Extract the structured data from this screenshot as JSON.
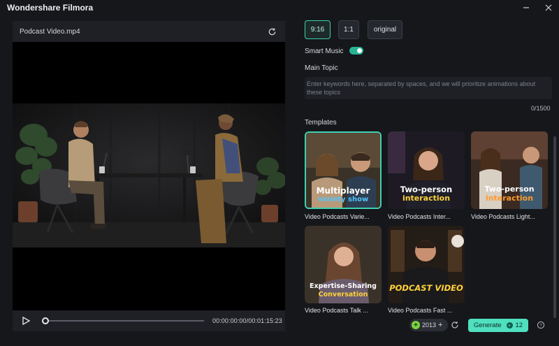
{
  "app": {
    "title": "Wondershare Filmora"
  },
  "preview": {
    "file_name": "Podcast Video.mp4",
    "time": "00:00:00:00/00:01:15:23"
  },
  "aspect_ratios": [
    "9:16",
    "1:1",
    "original"
  ],
  "selected_ratio": "9:16",
  "smart_music": {
    "label": "Smart Music",
    "enabled": true
  },
  "main_topic": {
    "label": "Main Topic",
    "placeholder": "Enter keywords here, separated by spaces, and we will prioritize animations about these topics",
    "count": "0/1500"
  },
  "templates": {
    "label": "Templates",
    "items": [
      {
        "name": "Video Podcasts Varie...",
        "overlay": [
          "Multiplayer",
          "variety show"
        ],
        "selected": true
      },
      {
        "name": "Video Podcasts Inter...",
        "overlay": [
          "Two-person",
          "interaction"
        ],
        "selected": false
      },
      {
        "name": "Video Podcasts Light...",
        "overlay": [
          "Two-person",
          "interaction"
        ],
        "selected": false
      },
      {
        "name": "Video Podcasts Talk ...",
        "overlay": [
          "Expertise-Sharing",
          "Conversation"
        ],
        "selected": false
      },
      {
        "name": "Video Podcasts Fast ...",
        "overlay": [
          "PODCAST VIDEO"
        ],
        "selected": false
      }
    ]
  },
  "footer": {
    "credits": "2013",
    "generate_label": "Generate",
    "generate_cost": "12"
  },
  "colors": {
    "accent": "#3fd0b0",
    "generate": "#4fe0bf",
    "background": "#15171b"
  }
}
